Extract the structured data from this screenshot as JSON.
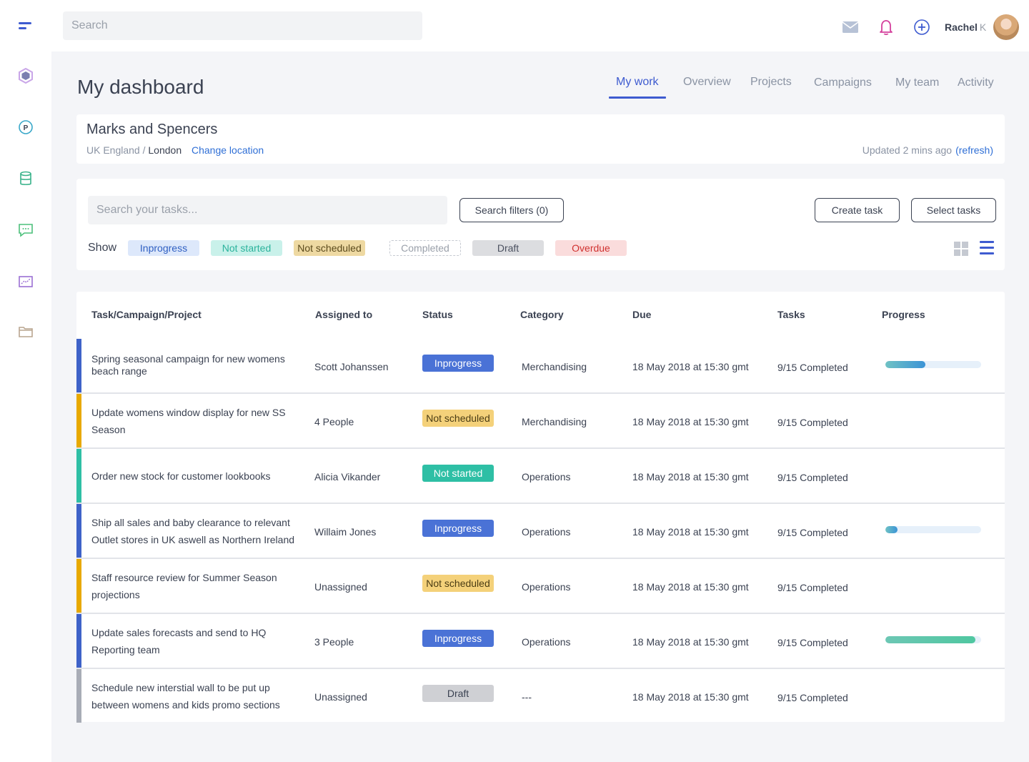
{
  "sidebar": {
    "items": [
      {
        "icon": "menu-icon"
      },
      {
        "icon": "hexagon-icon",
        "color": "#9b6fd4"
      },
      {
        "icon": "parking-icon",
        "color": "#3aa8c9"
      },
      {
        "icon": "database-icon",
        "color": "#38b28a"
      },
      {
        "icon": "chat-icon",
        "color": "#4cc07b"
      },
      {
        "icon": "chart-icon",
        "color": "#9b6fd4"
      },
      {
        "icon": "folder-icon",
        "color": "#b9a58f"
      }
    ]
  },
  "topbar": {
    "search_placeholder": "Search",
    "user_first": "Rachel",
    "user_last": "K"
  },
  "header": {
    "title": "My dashboard",
    "tabs": [
      {
        "label": "My work",
        "active": true
      },
      {
        "label": "Overview"
      },
      {
        "label": "Projects"
      },
      {
        "label": "Campaigns"
      },
      {
        "label": "My team"
      },
      {
        "label": "Activity"
      }
    ]
  },
  "company": {
    "name": "Marks and Spencers",
    "region": "UK England /",
    "city": "London",
    "change_location": "Change location",
    "updated": "Updated 2 mins ago",
    "refresh": "(refresh)"
  },
  "filters": {
    "search_placeholder": "Search your tasks...",
    "search_filters": "Search filters (0)",
    "create_task": "Create task",
    "select_tasks": "Select tasks",
    "show_label": "Show",
    "chips": [
      {
        "label": "Inprogress",
        "bg": "#dde8fb",
        "color": "#2f5fc2"
      },
      {
        "label": "Not started",
        "bg": "#c9f1ea",
        "color": "#2bb39c"
      },
      {
        "label": "Not scheduled",
        "bg": "#eed9a2",
        "color": "#5b4a1c"
      },
      {
        "label": "Completed",
        "bg": "#ffffff",
        "color": "#9aa0aa"
      },
      {
        "label": "Draft",
        "bg": "#dcdde0",
        "color": "#4b5160"
      },
      {
        "label": "Overdue",
        "bg": "#fadcdc",
        "color": "#d0312f"
      }
    ]
  },
  "table": {
    "headers": [
      "Task/Campaign/Project",
      "Assigned to",
      "Status",
      "Category",
      "Due",
      "Tasks",
      "Progress"
    ],
    "rows": [
      {
        "task": "Spring seasonal campaign for new womens beach range",
        "assigned": "Scott Johanssen",
        "status": "Inprogress",
        "category": "Merchandising",
        "due": "18 May 2018 at 15:30 gmt",
        "tasks": "9/15 Completed",
        "progress": 0.42,
        "bar": "#3e62c8"
      },
      {
        "task": "Update womens window display for new SS Season",
        "assigned": "4 People",
        "status": "Not scheduled",
        "category": "Merchandising",
        "due": "18 May 2018 at 15:30 gmt",
        "tasks": "9/15 Completed",
        "progress": null,
        "bar": "#e8a900"
      },
      {
        "task": "Order new stock for customer lookbooks",
        "assigned": "Alicia Vikander",
        "status": "Not started",
        "category": "Operations",
        "due": "18 May 2018 at 15:30 gmt",
        "tasks": "9/15 Completed",
        "progress": null,
        "bar": "#2ebfa5"
      },
      {
        "task": "Ship all sales and baby clearance to relevant Outlet stores in UK aswell as Northern Ireland",
        "assigned": "Willaim Jones",
        "status": "Inprogress",
        "category": "Operations",
        "due": "18 May 2018 at 15:30 gmt",
        "tasks": "9/15 Completed",
        "progress": 0.13,
        "bar": "#3e62c8"
      },
      {
        "task": "Staff resource review for Summer Season projections",
        "assigned": "Unassigned",
        "status": "Not scheduled",
        "category": "Operations",
        "due": "18 May 2018 at 15:30 gmt",
        "tasks": "9/15 Completed",
        "progress": null,
        "bar": "#e8a900"
      },
      {
        "task": "Update sales forecasts and send to HQ Reporting team",
        "assigned": "3 People",
        "status": "Inprogress",
        "category": "Operations",
        "due": "18 May 2018 at 15:30 gmt",
        "tasks": "9/15 Completed",
        "progress": 0.94,
        "bar": "#3e62c8"
      },
      {
        "task": "Schedule new interstial wall to be put up between womens and kids promo sections",
        "assigned": "Unassigned",
        "status": "Draft",
        "category": "---",
        "due": "18 May 2018 at 15:30 gmt",
        "tasks": "9/15 Completed",
        "progress": null,
        "bar": "#a8acb6"
      }
    ]
  },
  "status_styles": {
    "Inprogress": {
      "bg": "#4a72d6",
      "color": "#ffffff"
    },
    "Not scheduled": {
      "bg": "#f4d17a",
      "color": "#4a3c14"
    },
    "Not started": {
      "bg": "#2ebfa5",
      "color": "#ffffff"
    },
    "Draft": {
      "bg": "#cfd0d4",
      "color": "#3b4252"
    }
  }
}
